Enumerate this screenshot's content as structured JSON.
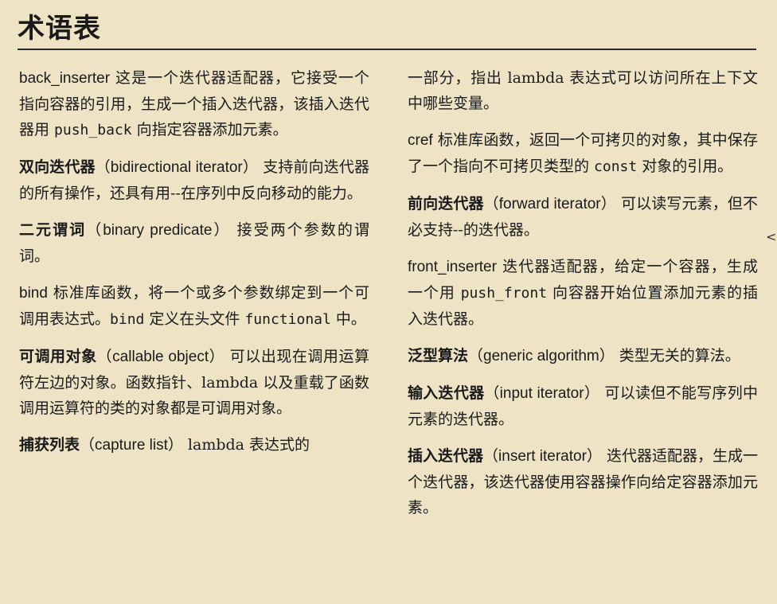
{
  "title": "术语表",
  "left": [
    {
      "term": "back_inserter",
      "def_a": " 这是一个迭代器适配器，它接受一个指向容器的引用，生成一个插入迭代器，该插入迭代器用 ",
      "code": "push_back",
      "def_b": " 向指定容器添加元素。"
    },
    {
      "term_zh": "双向迭代器",
      "term_en": "（bidirectional iterator）",
      "def": " 支持前向迭代器的所有操作，还具有用--在序列中反向移动的能力。"
    },
    {
      "term_zh": "二元谓词",
      "term_en": "（binary predicate）",
      "def": " 接受两个参数的谓词。"
    },
    {
      "term": "bind",
      "def_a": " 标准库函数，将一个或多个参数绑定到一个可调用表达式。",
      "code": "bind",
      "def_b": " 定义在头文件 ",
      "code2": "functional",
      "def_c": " 中。"
    },
    {
      "term_zh": "可调用对象",
      "term_en": "（callable object）",
      "def": " 可以出现在调用运算符左边的对象。函数指针、lambda 以及重载了函数调用运算符的类的对象都是可调用对象。"
    },
    {
      "term_zh": "捕获列表",
      "term_en": "（capture list）",
      "def": " lambda 表达式的"
    }
  ],
  "right": [
    {
      "def": "一部分，指出 lambda 表达式可以访问所在上下文中哪些变量。"
    },
    {
      "term": "cref",
      "def_a": " 标准库函数，返回一个可拷贝的对象，其中保存了一个指向不可拷贝类型的 ",
      "code": "const",
      "def_b": " 对象的引用。"
    },
    {
      "term_zh": "前向迭代器",
      "term_en": "（forward iterator）",
      "def": " 可以读写元素，但不必支持--的迭代器。"
    },
    {
      "term": "front_inserter",
      "def_a": " 迭代器适配器，给定一个容器，生成一个用 ",
      "code": "push_front",
      "def_b": " 向容器开始位置添加元素的插入迭代器。"
    },
    {
      "term_zh": "泛型算法",
      "term_en": "（generic algorithm）",
      "def": " 类型无关的算法。"
    },
    {
      "term_zh": "输入迭代器",
      "term_en": "（input iterator）",
      "def": " 可以读但不能写序列中元素的迭代器。"
    },
    {
      "term_zh": "插入迭代器",
      "term_en": "（insert iterator）",
      "def": " 迭代器适配器，生成一个迭代器，该迭代器使用容器操作向给定容器添加元素。"
    }
  ],
  "margin_mark": "<"
}
